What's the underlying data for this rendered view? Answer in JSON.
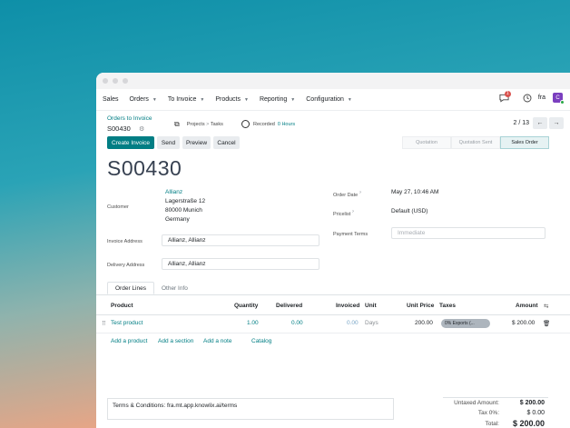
{
  "menu": {
    "items": [
      {
        "label": "Sales",
        "dropdown": false
      },
      {
        "label": "Orders",
        "dropdown": true
      },
      {
        "label": "To Invoice",
        "dropdown": true
      },
      {
        "label": "Products",
        "dropdown": true
      },
      {
        "label": "Reporting",
        "dropdown": true
      },
      {
        "label": "Configuration",
        "dropdown": true
      }
    ],
    "message_count": "1",
    "language": "fra",
    "avatar_initial": "C"
  },
  "breadcrumb": {
    "parent": "Orders to Invoice",
    "current": "S00430"
  },
  "smart_buttons": {
    "projects": "Projects",
    "separator": ">",
    "tasks": "Tasks",
    "recorded": "Recorded",
    "hours": "0 Hours"
  },
  "pager": {
    "text": "2 / 13",
    "prev": "←",
    "next": "→"
  },
  "actions": {
    "create_invoice": "Create Invoice",
    "send": "Send",
    "preview": "Preview",
    "cancel": "Cancel"
  },
  "status": {
    "stages": [
      "Quotation",
      "Quotation Sent",
      "Sales Order"
    ],
    "active_index": 2
  },
  "form": {
    "title": "S00430",
    "customer_label": "Customer",
    "customer_name": "Allianz",
    "address_line1": "Lagerstraße 12",
    "address_line2": "80000 Munich",
    "address_line3": "Germany",
    "invoice_address_label": "Invoice Address",
    "invoice_address": "Allianz, Allianz",
    "delivery_address_label": "Delivery Address",
    "delivery_address": "Allianz, Allianz",
    "order_date_label": "Order Date",
    "order_date": "May 27, 10:46 AM",
    "pricelist_label": "Pricelist",
    "pricelist": "Default (USD)",
    "payment_terms_label": "Payment Terms",
    "payment_terms_placeholder": "Immediate",
    "help_mark": "?"
  },
  "tabs": [
    "Order Lines",
    "Other Info"
  ],
  "table": {
    "headers": {
      "product": "Product",
      "quantity": "Quantity",
      "delivered": "Delivered",
      "invoiced": "Invoiced",
      "unit": "Unit",
      "unit_price": "Unit Price",
      "taxes": "Taxes",
      "amount": "Amount"
    },
    "rows": [
      {
        "product": "Test product",
        "quantity": "1.00",
        "delivered": "0.00",
        "invoiced": "0.00",
        "unit": "Days",
        "unit_price": "200.00",
        "taxes": "0% Exports (...",
        "amount": "$ 200.00"
      }
    ],
    "add_product": "Add a product",
    "add_section": "Add a section",
    "add_note": "Add a note",
    "catalog": "Catalog"
  },
  "footer": {
    "terms": "Terms & Conditions: fra.mt.app.knowlix.ai/terms",
    "untaxed_label": "Untaxed Amount:",
    "untaxed_value": "$ 200.00",
    "tax_label": "Tax 0%:",
    "tax_value": "$ 0.00",
    "total_label": "Total:",
    "total_value": "$ 200.00"
  },
  "colors": {
    "accent": "#017e84",
    "avatar": "#7b3fbf",
    "badge": "#d9534f"
  }
}
